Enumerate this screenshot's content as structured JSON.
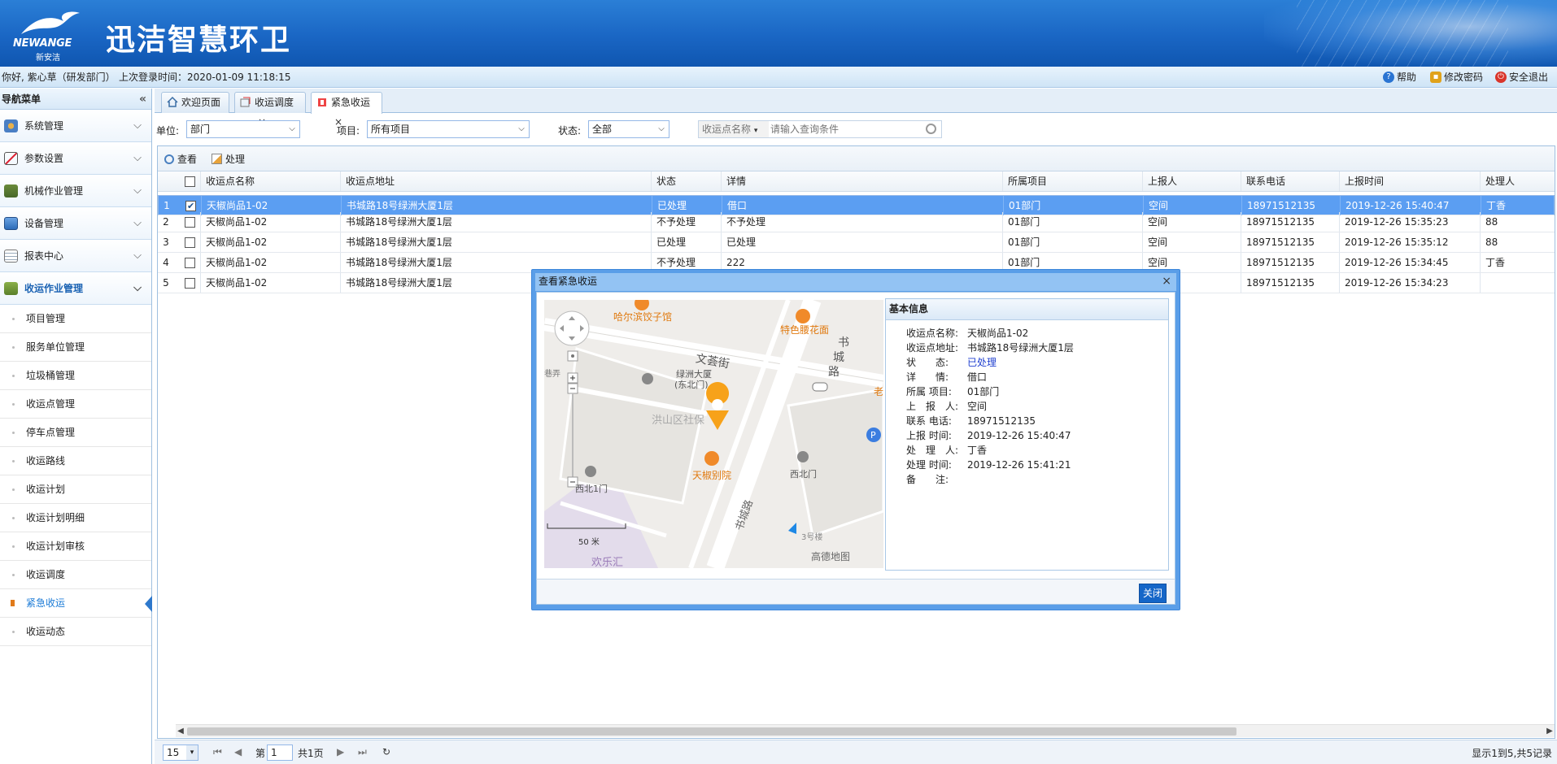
{
  "brand": {
    "logo_text": "NEWANGE",
    "logo_sub": "新安洁",
    "app_title": "迅洁智慧环卫"
  },
  "userbar": {
    "greeting": "你好, 紫心草（研发部门）",
    "last_login": "上次登录时间：2020-01-09 11:18:15",
    "help": "帮助",
    "change_password": "修改密码",
    "logout": "安全退出"
  },
  "sidebar": {
    "title": "导航菜单",
    "groups": [
      {
        "label": "系统管理",
        "icon": "settings-gear-icon"
      },
      {
        "label": "参数设置",
        "icon": "chart-icon"
      },
      {
        "label": "机械作业管理",
        "icon": "truck-icon"
      },
      {
        "label": "设备管理",
        "icon": "monitor-icon"
      },
      {
        "label": "报表中心",
        "icon": "report-icon"
      },
      {
        "label": "收运作业管理",
        "icon": "garbage-truck-icon"
      }
    ],
    "subitems": [
      "项目管理",
      "服务单位管理",
      "垃圾桶管理",
      "收运点管理",
      "停车点管理",
      "收运路线",
      "收运计划",
      "收运计划明细",
      "收运计划审核",
      "收运调度",
      "紧急收运",
      "收运动态"
    ],
    "active_sub": "紧急收运"
  },
  "tabs": [
    {
      "label": "欢迎页面"
    },
    {
      "label": "收运调度"
    },
    {
      "label": "紧急收运"
    }
  ],
  "filters": {
    "unit_label": "单位:",
    "unit_value": "部门",
    "project_label": "项目:",
    "project_value": "所有项目",
    "status_label": "状态:",
    "status_value": "全部",
    "search_category": "收运点名称",
    "search_placeholder": "请输入查询条件"
  },
  "toolbar": {
    "view": "查看",
    "process": "处理"
  },
  "table": {
    "headers": [
      "收运点名称",
      "收运点地址",
      "状态",
      "详情",
      "所属项目",
      "上报人",
      "联系电话",
      "上报时间",
      "处理人"
    ],
    "rows": [
      {
        "n": "1",
        "checked": true,
        "c": [
          "天椒尚品1-02",
          "书城路18号绿洲大厦1层",
          "已处理",
          "借口",
          "01部门",
          "空间",
          "18971512135",
          "2019-12-26 15:40:47",
          "丁香"
        ]
      },
      {
        "n": "2",
        "checked": false,
        "c": [
          "天椒尚品1-02",
          "书城路18号绿洲大厦1层",
          "不予处理",
          "不予处理",
          "01部门",
          "空间",
          "18971512135",
          "2019-12-26 15:35:23",
          "88"
        ]
      },
      {
        "n": "3",
        "checked": false,
        "c": [
          "天椒尚品1-02",
          "书城路18号绿洲大厦1层",
          "已处理",
          "已处理",
          "01部门",
          "空间",
          "18971512135",
          "2019-12-26 15:35:12",
          "88"
        ]
      },
      {
        "n": "4",
        "checked": false,
        "c": [
          "天椒尚品1-02",
          "书城路18号绿洲大厦1层",
          "不予处理",
          "222",
          "01部门",
          "空间",
          "18971512135",
          "2019-12-26 15:34:45",
          "丁香"
        ]
      },
      {
        "n": "5",
        "checked": false,
        "c": [
          "天椒尚品1-02",
          "书城路18号绿洲大厦1层",
          "",
          "",
          "",
          "",
          "18971512135",
          "2019-12-26 15:34:23",
          ""
        ]
      }
    ]
  },
  "pager": {
    "page_size": "15",
    "page_prefix": "第",
    "page_value": "1",
    "page_suffix": "共1页",
    "info": "显示1到5,共5记录"
  },
  "modal": {
    "title": "查看紧急收运",
    "close_label": "关闭",
    "map": {
      "labels": [
        "哈尔滨饺子馆",
        "特色腰花面",
        "文荟街",
        "书",
        "城",
        "路",
        "绿洲大厦",
        "(东北门)",
        "洪山区社保",
        "天椒别院",
        "西北1门",
        "西北门",
        "书城路",
        "3号楼",
        "欢乐汇",
        "老",
        "50 米",
        "高德地图",
        "巷弄"
      ]
    },
    "info_title": "基本信息",
    "fields": [
      {
        "k": "收运点名称:",
        "v": "天椒尚品1-02"
      },
      {
        "k": "收运点地址:",
        "v": "书城路18号绿洲大厦1层"
      },
      {
        "k": "状　　态:",
        "v": "已处理"
      },
      {
        "k": "详　　情:",
        "v": "借口"
      },
      {
        "k": "所属 项目:",
        "v": "01部门"
      },
      {
        "k": "上　报　人:",
        "v": "空间"
      },
      {
        "k": "联系 电话:",
        "v": "18971512135"
      },
      {
        "k": "上报 时间:",
        "v": "2019-12-26 15:40:47"
      },
      {
        "k": "处　理　人:",
        "v": "丁香"
      },
      {
        "k": "处理 时间:",
        "v": "2019-12-26 15:41:21"
      },
      {
        "k": "备　　注:",
        "v": ""
      }
    ]
  }
}
